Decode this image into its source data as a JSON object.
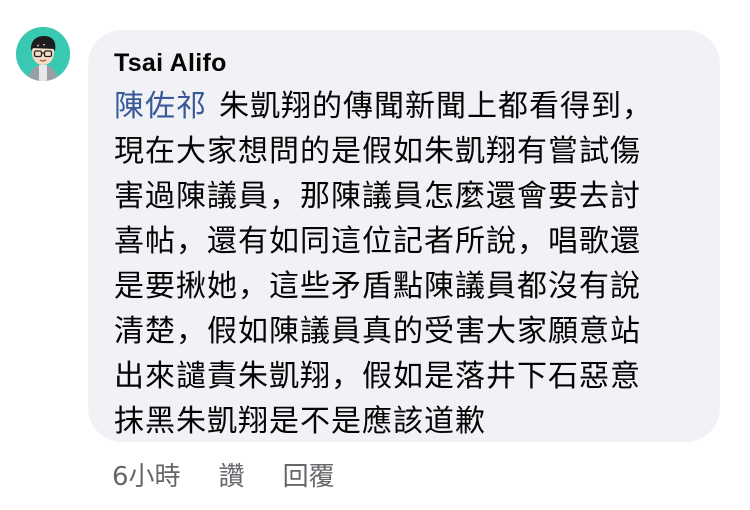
{
  "comment": {
    "author": "Tsai Alifo",
    "mention": "陳佐祁",
    "body_first_line": "朱凱翔的傳聞新聞上都看得到，",
    "body_rest": "現在大家想問的是假如朱凱翔有嘗試傷\n害過陳議員，那陳議員怎麼還會要去討\n喜帖，還有如同這位記者所說，唱歌還\n是要揪她，這些矛盾點陳議員都沒有說\n清楚，假如陳議員真的受害大家願意站\n出來譴責朱凱翔，假如是落井下石惡意\n抹黑朱凱翔是不是應該道歉"
  },
  "actions": {
    "timestamp": "6小時",
    "like_label": "讚",
    "reply_label": "回覆"
  },
  "colors": {
    "bubble": "#f0f2f5",
    "mention": "#385898",
    "meta_text": "#65676b",
    "avatar_bg": "#39c9b3"
  },
  "icons": {
    "avatar": "cartoon-person-avatar"
  }
}
